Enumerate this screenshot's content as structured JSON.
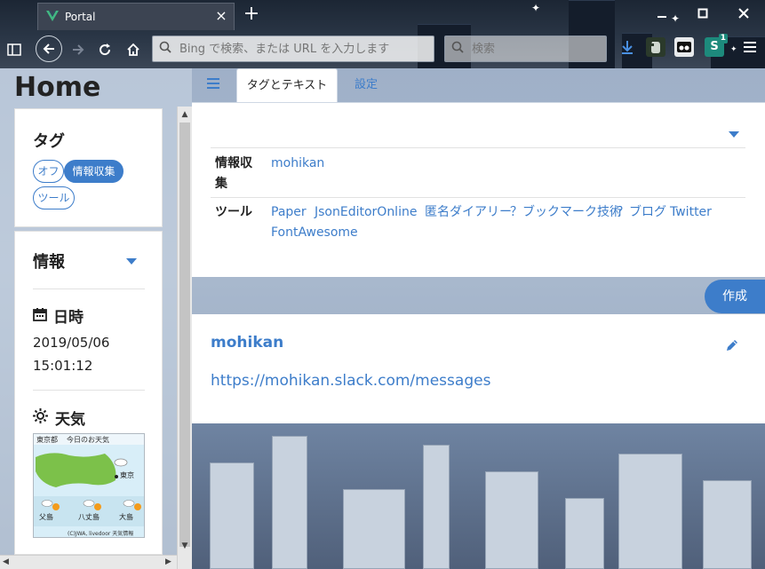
{
  "browser": {
    "tab_title": "Portal",
    "tab_close": "×",
    "new_tab": "+",
    "url_placeholder": "Bing で検索、または URL を入力します",
    "search_placeholder": "検索",
    "ext_badge": "1",
    "ext_s": "S"
  },
  "page": {
    "home_title": "Home",
    "tag_card": {
      "title": "タグ",
      "chips": [
        "オフ",
        "情報収集",
        "ツール"
      ],
      "active_chip": "情報収集"
    },
    "info_card": {
      "title": "情報",
      "datetime_label": "日時",
      "date": "2019/05/06",
      "time": "15:01:12",
      "weather_label": "天気",
      "weather_widget": {
        "region": "東京都",
        "title": "今日のお天気",
        "places": [
          "東京",
          "父島",
          "八丈島",
          "大島"
        ],
        "credit": "(C)JWA, livedoor 天気情報"
      }
    },
    "tabs": {
      "active": "タグとテキスト",
      "settings": "設定"
    },
    "tag_rows": [
      {
        "label": "情報収集",
        "links": [
          "mohikan"
        ]
      },
      {
        "label": "ツール",
        "links": [
          "Paper",
          "JsonEditorOnline",
          "匿名ダイアリー",
          "？ブックマーク技術",
          "？ブログ",
          "Twitter",
          "FontAwesome"
        ]
      }
    ],
    "create_button": "作成",
    "bookmark": {
      "title": "mohikan",
      "url": "https://mohikan.slack.com/messages"
    }
  },
  "colors": {
    "accent": "#3d7dca",
    "chrome_bg": "#1c2634"
  }
}
